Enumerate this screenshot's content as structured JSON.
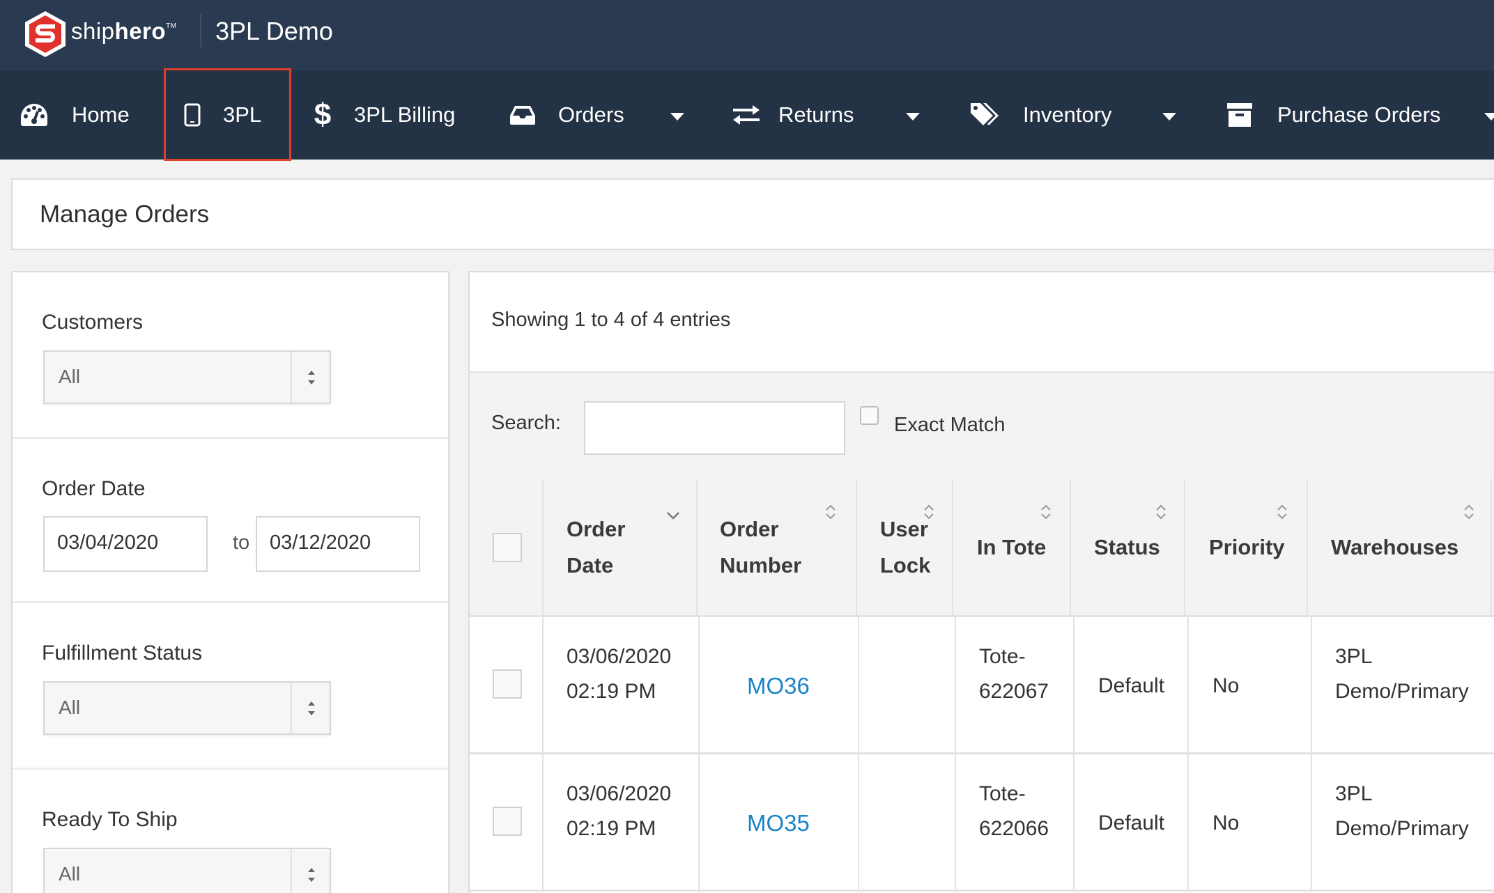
{
  "brand": {
    "name_light": "ship",
    "name_bold": "hero",
    "tm": "TM"
  },
  "app_title": "3PL Demo",
  "nav": {
    "home": "Home",
    "tpl": "3PL",
    "billing": "3PL Billing",
    "orders": "Orders",
    "returns": "Returns",
    "inventory": "Inventory",
    "purchase_orders": "Purchase Orders"
  },
  "page_title": "Manage Orders",
  "filters": {
    "customers": {
      "label": "Customers",
      "value": "All"
    },
    "order_date": {
      "label": "Order Date",
      "from": "03/04/2020",
      "to_label": "to",
      "to": "03/12/2020"
    },
    "fulfillment_status": {
      "label": "Fulfillment Status",
      "value": "All"
    },
    "ready_to_ship": {
      "label": "Ready To Ship",
      "value": "All"
    }
  },
  "table_info": "Showing 1 to 4 of 4 entries",
  "search": {
    "label": "Search:",
    "value": "",
    "exact_match": "Exact Match"
  },
  "columns": {
    "order_date": [
      "Order",
      "Date"
    ],
    "order_number": [
      "Order",
      "Number"
    ],
    "user_lock": [
      "User",
      "Lock"
    ],
    "in_tote": "In Tote",
    "status": "Status",
    "priority": "Priority",
    "warehouses": "Warehouses"
  },
  "rows": [
    {
      "date": "03/06/2020",
      "time": "02:19 PM",
      "order_number": "MO36",
      "user_lock": "",
      "tote_1": "Tote-",
      "tote_2": "622067",
      "status": "Default",
      "priority": "No",
      "wh_1": "3PL",
      "wh_2": "Demo/Primary"
    },
    {
      "date": "03/06/2020",
      "time": "02:19 PM",
      "order_number": "MO35",
      "user_lock": "",
      "tote_1": "Tote-",
      "tote_2": "622066",
      "status": "Default",
      "priority": "No",
      "wh_1": "3PL",
      "wh_2": "Demo/Primary"
    }
  ],
  "colors": {
    "topbar": "#2a3a51",
    "navbar": "#243246",
    "active_outline": "#e0402a",
    "link": "#1a84c7",
    "logo_red": "#e0312b"
  },
  "icons": [
    "shiphero-logo",
    "dashboard-icon",
    "tablet-icon",
    "dollar-icon",
    "inbox-icon",
    "exchange-icon",
    "tags-icon",
    "archive-icon"
  ]
}
